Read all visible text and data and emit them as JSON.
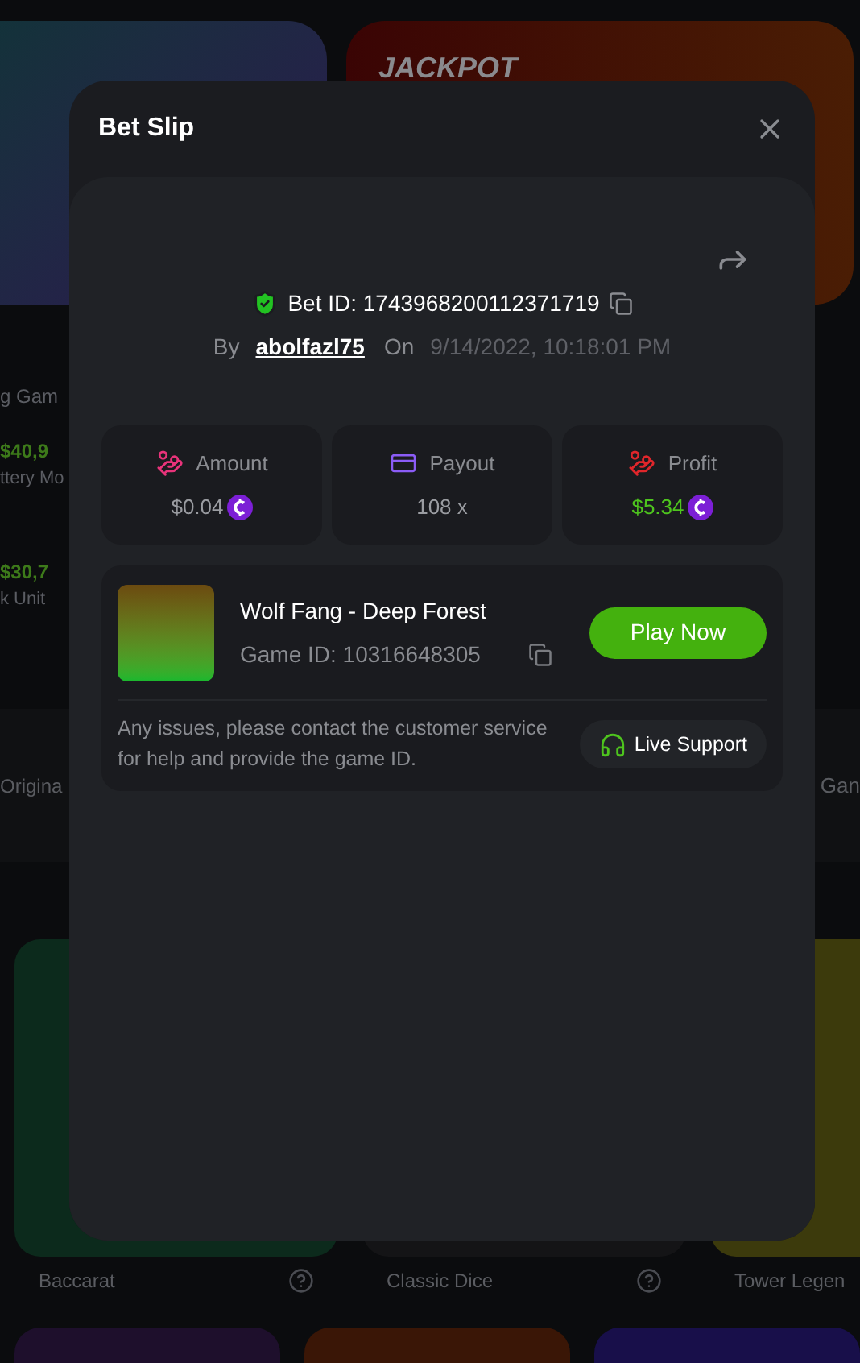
{
  "background": {
    "banner_title": "JACKPOT",
    "side_texts": [
      {
        "kind": "title",
        "text": "g Gam"
      },
      {
        "kind": "amount",
        "text": "$40,9"
      },
      {
        "kind": "subtitle",
        "text": "ttery Mo"
      },
      {
        "kind": "amount",
        "text": "$30,7"
      },
      {
        "kind": "subtitle",
        "text": "k Unit"
      }
    ],
    "tab_left": "Origina",
    "tab_right": "Gan",
    "games": [
      {
        "name": "Baccarat",
        "help_icon": true
      },
      {
        "name": "Classic Dice",
        "help_icon": true
      },
      {
        "name": "Tower Legen"
      }
    ]
  },
  "modal": {
    "title": "Bet Slip",
    "bet_id": "Bet ID: 1743968200112371719",
    "by_label": "By",
    "user": "abolfazl75",
    "on_label": "On",
    "date": "9/14/2022, 10:18:01 PM",
    "stats": [
      {
        "kind": "amount",
        "label": "Amount",
        "value": "$0.04",
        "coin": true
      },
      {
        "kind": "payout",
        "label": "Payout",
        "value": "108 x",
        "coin": false
      },
      {
        "kind": "profit",
        "label": "Profit",
        "value": "$5.34",
        "coin": true
      }
    ],
    "game": {
      "name": "Wolf Fang - Deep Forest",
      "game_id": "Game ID: 10316648305",
      "play_button": "Play Now",
      "notice": "Any issues, please contact the customer service for help and provide the game ID.",
      "support_button": "Live Support"
    }
  }
}
